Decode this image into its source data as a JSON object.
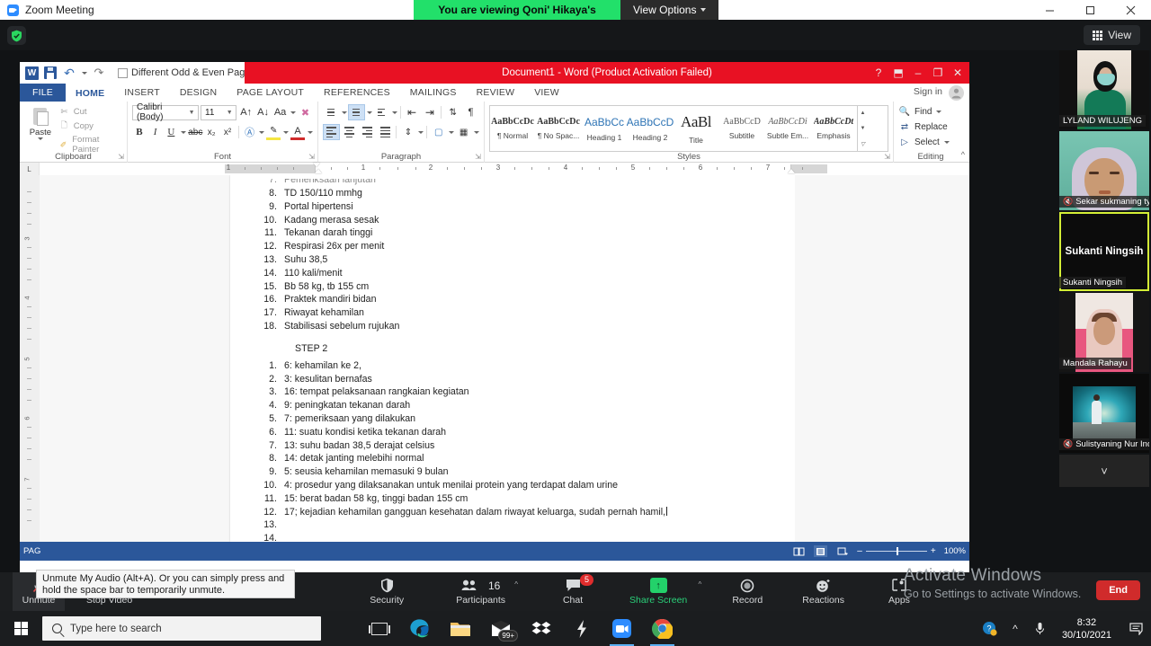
{
  "zoom_window": {
    "title": "Zoom Meeting",
    "viewing_banner": "You are viewing Qoni' Hikaya's screen",
    "view_options_label": "View Options",
    "view_button_label": "View",
    "minimize": "–",
    "maximize": "☐",
    "close": "✕"
  },
  "word": {
    "qat": {
      "odd_even_label": "Different Odd & Even Pages",
      "undo": "undo-arrow",
      "redo": "redo-arrow"
    },
    "titlebar": "Document1  -  Word (Product Activation Failed)",
    "window_controls": {
      "help": "?",
      "ribbon_display": "⬒",
      "minimize": "–",
      "restore": "❐",
      "close": "✕"
    },
    "tabs": [
      {
        "label": "FILE",
        "state": "file"
      },
      {
        "label": "HOME",
        "state": "active"
      },
      {
        "label": "INSERT",
        "state": "normal"
      },
      {
        "label": "DESIGN",
        "state": "normal"
      },
      {
        "label": "PAGE LAYOUT",
        "state": "normal"
      },
      {
        "label": "REFERENCES",
        "state": "normal"
      },
      {
        "label": "MAILINGS",
        "state": "normal"
      },
      {
        "label": "REVIEW",
        "state": "normal"
      },
      {
        "label": "VIEW",
        "state": "normal"
      }
    ],
    "sign_in": "Sign in",
    "groups": {
      "clipboard": {
        "label": "Clipboard",
        "paste": "Paste",
        "items": [
          {
            "label": "Cut",
            "icon": "scissors-icon"
          },
          {
            "label": "Copy",
            "icon": "copy-icon"
          },
          {
            "label": "Format Painter",
            "icon": "paintbrush-icon"
          }
        ]
      },
      "font": {
        "label": "Font",
        "font_name": "Calibri (Body)",
        "font_size": "11",
        "buttons": [
          "B",
          "I",
          "U",
          "abc",
          "x₂",
          "x²"
        ]
      },
      "paragraph": {
        "label": "Paragraph"
      },
      "styles": {
        "label": "Styles",
        "items": [
          {
            "preview": "AaBbCcDc",
            "name": "¶ Normal",
            "cls": "norm"
          },
          {
            "preview": "AaBbCcDc",
            "name": "¶ No Spac...",
            "cls": "nospace"
          },
          {
            "preview": "AaBbCс",
            "name": "Heading 1",
            "cls": "h1"
          },
          {
            "preview": "AaBbCcD",
            "name": "Heading 2",
            "cls": "h2"
          },
          {
            "preview": "AaBl",
            "name": "Title",
            "cls": "title"
          },
          {
            "preview": "AaBbCcD",
            "name": "Subtitle",
            "cls": "sub"
          },
          {
            "preview": "AaBbCcDi",
            "name": "Subtle Em...",
            "cls": "subem"
          },
          {
            "preview": "AaBbCcDt",
            "name": "Emphasis",
            "cls": "emph"
          }
        ]
      },
      "editing": {
        "label": "Editing",
        "items": [
          {
            "label": "Find",
            "icon": "binoculars-icon"
          },
          {
            "label": "Replace",
            "icon": "replace-icon"
          },
          {
            "label": "Select",
            "icon": "cursor-select-icon"
          }
        ]
      }
    },
    "ruler": {
      "numbers": [
        "1",
        "1",
        "2",
        "3",
        "4",
        "5",
        "6",
        "7"
      ]
    },
    "document": {
      "list1": [
        {
          "num": "7.",
          "text": "Pemeriksaan lanjutan",
          "clipped": true
        },
        {
          "num": "8.",
          "text": "TD 150/110 mmhg"
        },
        {
          "num": "9.",
          "text": "Portal hipertensi"
        },
        {
          "num": "10.",
          "text": "Kadang merasa sesak"
        },
        {
          "num": "11.",
          "text": "Tekanan darah tinggi"
        },
        {
          "num": "12.",
          "text": "Respirasi 26x per menit"
        },
        {
          "num": "13.",
          "text": "Suhu 38,5"
        },
        {
          "num": "14.",
          "text": "110 kali/menit"
        },
        {
          "num": "15.",
          "text": "Bb 58 kg, tb 155 cm"
        },
        {
          "num": "16.",
          "text": "Praktek mandiri bidan"
        },
        {
          "num": "17.",
          "text": "Riwayat kehamilan"
        },
        {
          "num": "18.",
          "text": "Stabilisasi sebelum rujukan"
        }
      ],
      "heading": "STEP 2",
      "list2": [
        {
          "num": "1.",
          "text": "6: kehamilan ke 2,"
        },
        {
          "num": "2.",
          "text": "3: kesulitan bernafas"
        },
        {
          "num": "3.",
          "text": "16: tempat pelaksanaan rangkaian kegiatan"
        },
        {
          "num": "4.",
          "text": "9: peningkatan tekanan darah"
        },
        {
          "num": "5.",
          "text": "7: pemeriksaan yang dilakukan"
        },
        {
          "num": "6.",
          "text": "11: suatu kondisi ketika tekanan darah"
        },
        {
          "num": "7.",
          "text": "13: suhu badan 38,5 derajat celsius"
        },
        {
          "num": "8.",
          "text": "14: detak janting melebihi normal"
        },
        {
          "num": "9.",
          "text": "5: seusia kehamilan memasuki 9 bulan"
        },
        {
          "num": "10.",
          "text": "4: prosedur yang dilaksanakan untuk menilai protein yang terdapat dalam urine"
        },
        {
          "num": "11.",
          "text": "15: berat badan 58 kg, tinggi badan 155 cm"
        },
        {
          "num": "12.",
          "text": "17; kejadian kehamilan gangguan kesehatan dalam riwayat keluarga, sudah pernah hamil,",
          "caret": true
        },
        {
          "num": "13.",
          "text": ""
        },
        {
          "num": "14.",
          "text": ""
        }
      ]
    },
    "status_bar": {
      "left_label": "PAG",
      "zoom_level": "100%",
      "zoom_out": "–",
      "zoom_in": "+"
    }
  },
  "participants": [
    {
      "name": "LYLAND WILUJENG",
      "muted": false,
      "active": false,
      "video": "vid-a",
      "centered": false
    },
    {
      "name": "Sekar sukmaning tyas",
      "muted": true,
      "active": false,
      "video": "vid-b",
      "centered": false
    },
    {
      "name": "Sukanti Ningsih",
      "display_name": "Sukanti Ningsih",
      "muted": false,
      "active": true,
      "video": "none",
      "centered": true
    },
    {
      "name": "Mandala Rahayu",
      "muted": false,
      "active": false,
      "video": "vid-c",
      "centered": false
    },
    {
      "name": "Sulistyaning Nur Inda...",
      "muted": true,
      "active": false,
      "video": "vid-d",
      "centered": false
    }
  ],
  "filmstrip": {
    "more_label": "˅"
  },
  "toolbar": {
    "items": [
      {
        "label": "Unmute",
        "icon": "microphone-muted-icon",
        "caret": true,
        "highlight": true
      },
      {
        "label": "Stop Video",
        "icon": "video-camera-icon",
        "caret": true
      },
      {
        "label": "Security",
        "icon": "shield-icon"
      },
      {
        "label": "Participants",
        "icon": "people-icon",
        "count": "16",
        "caret": true
      },
      {
        "label": "Chat",
        "icon": "chat-bubble-icon",
        "badge": "5"
      },
      {
        "label": "Share Screen",
        "icon": "share-screen-icon",
        "caret": true,
        "green": true
      },
      {
        "label": "Record",
        "icon": "record-circle-icon"
      },
      {
        "label": "Reactions",
        "icon": "smiley-reaction-icon"
      },
      {
        "label": "Apps",
        "icon": "apps-icon"
      }
    ],
    "end_label": "End"
  },
  "tooltip": {
    "text": "Unmute My Audio (Alt+A). Or you can simply press and hold the space bar to temporarily unmute."
  },
  "watermark": {
    "line1": "Activate Windows",
    "line2": "Go to Settings to activate Windows."
  },
  "taskbar": {
    "search_placeholder": "Type here to search",
    "icons": [
      {
        "name": "task-view-icon"
      },
      {
        "name": "edge-icon"
      },
      {
        "name": "file-explorer-icon"
      },
      {
        "name": "mail-icon",
        "badge": "99+"
      },
      {
        "name": "dropbox-icon"
      },
      {
        "name": "lightning-icon"
      },
      {
        "name": "zoom-icon",
        "running": true
      },
      {
        "name": "chrome-icon",
        "running": true
      }
    ],
    "tray": {
      "time": "8:32",
      "date": "30/10/2021"
    }
  },
  "colors": {
    "word_blue": "#2b579a",
    "word_red": "#e81123",
    "zoom_green": "#22e06a",
    "active_tile": "#d4ef36",
    "end_red": "#d02b2b"
  }
}
